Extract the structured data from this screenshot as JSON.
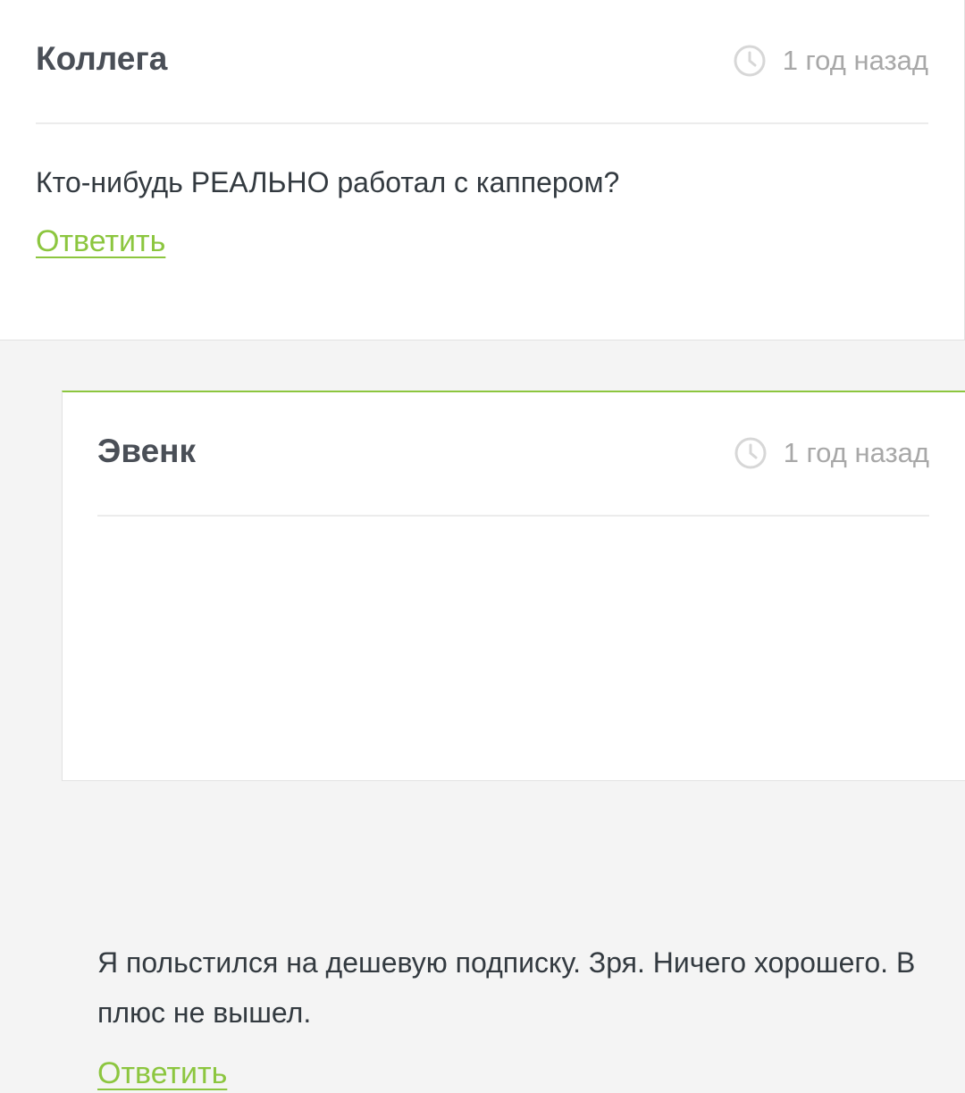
{
  "colors": {
    "accent": "#8cc63f",
    "author": "#4a4f57",
    "text": "#333a40",
    "muted": "#a8a8a8",
    "page_background": "#f4f4f4"
  },
  "comments": [
    {
      "author": "Коллега",
      "time_icon": "clock-icon",
      "time": "1 год назад",
      "text": "Кто-нибудь РЕАЛЬНО работал с каппером?",
      "reply_label": "Ответить"
    },
    {
      "author": "Эвенк",
      "time_icon": "clock-icon",
      "time": "1 год назад",
      "text": "Я польстился на дешевую подписку. Зря. Ничего хорошего. В плюс не вышел.",
      "reply_label": "Ответить"
    }
  ]
}
